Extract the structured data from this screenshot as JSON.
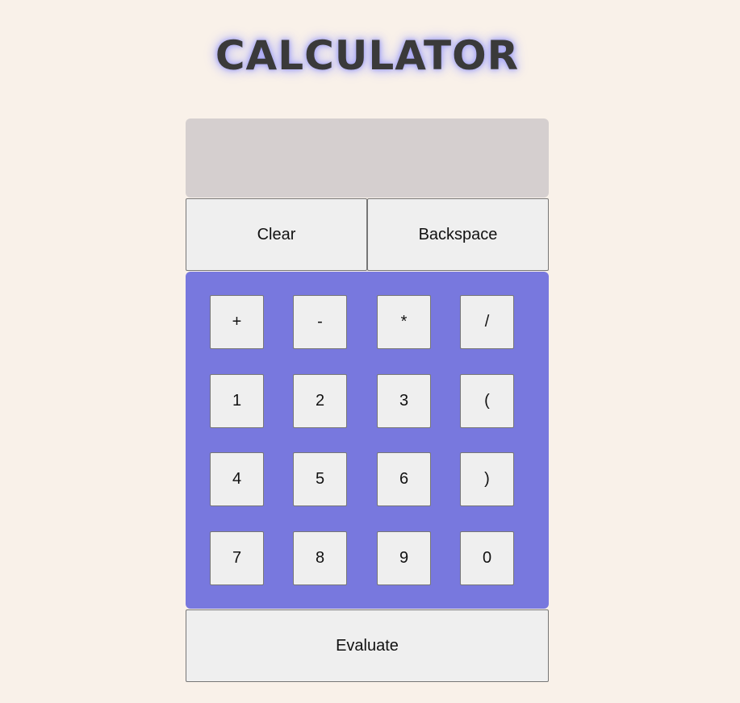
{
  "app": {
    "title": "CALCULATOR"
  },
  "display": {
    "value": ""
  },
  "controls": {
    "clear_label": "Clear",
    "backspace_label": "Backspace",
    "evaluate_label": "Evaluate"
  },
  "keypad": {
    "rows": [
      [
        "+",
        "-",
        "*",
        "/"
      ],
      [
        "1",
        "2",
        "3",
        "("
      ],
      [
        "4",
        "5",
        "6",
        ")"
      ],
      [
        "7",
        "8",
        "9",
        "0"
      ]
    ]
  },
  "colors": {
    "page_background": "#f9f1e9",
    "display_background": "#d5cfcf",
    "keypad_background": "#7878de",
    "button_background": "#efefef",
    "title_text": "#3a3a3a",
    "title_glow": "#9c9cf2"
  }
}
